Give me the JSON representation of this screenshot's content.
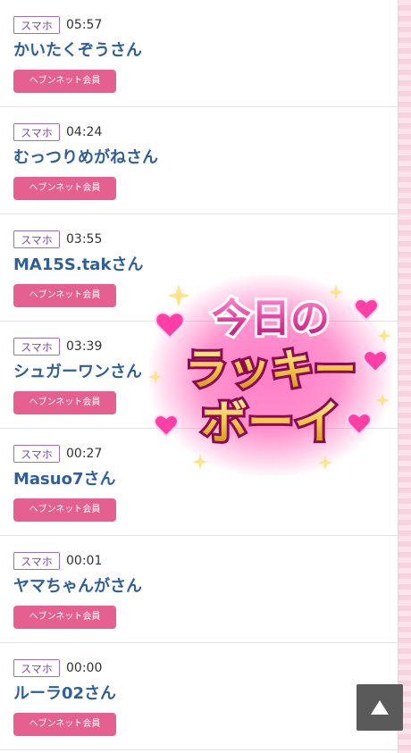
{
  "rows": [
    {
      "device": "スマホ",
      "time": "05:57",
      "name": "かいたくぞうさん",
      "badge": "ヘブンネット会員"
    },
    {
      "device": "スマホ",
      "time": "04:24",
      "name": "むっつりめがねさん",
      "badge": "ヘブンネット会員"
    },
    {
      "device": "スマホ",
      "time": "03:55",
      "name": "MA15S.takさん",
      "badge": "ヘブンネット会員"
    },
    {
      "device": "スマホ",
      "time": "03:39",
      "name": "シュガーワンさん",
      "badge": "ヘブンネット会員"
    },
    {
      "device": "スマホ",
      "time": "00:27",
      "name": "Masuo7さん",
      "badge": "ヘブンネット会員"
    },
    {
      "device": "スマホ",
      "time": "00:01",
      "name": "ヤマちゃんがさん",
      "badge": "ヘブンネット会員"
    },
    {
      "device": "スマホ",
      "time": "00:00",
      "name": "ルーラ02さん",
      "badge": "ヘブンネット会員"
    }
  ],
  "overlay": {
    "lines": [
      "今日の",
      "ラッキー",
      "ボーイ"
    ]
  },
  "colors": {
    "device_badge_border": "#9b6fc1",
    "name_text": "#2f5f9a",
    "member_badge_bg": "#e55f8f",
    "overlay_pink": "#e6399a",
    "overlay_gold": "#f4c542",
    "scroll_button_bg": "#5a5a5a"
  },
  "icons": {
    "scroll_top": "triangle-up-icon",
    "hearts": "heart-icon",
    "sparkles": "sparkle-icon"
  }
}
